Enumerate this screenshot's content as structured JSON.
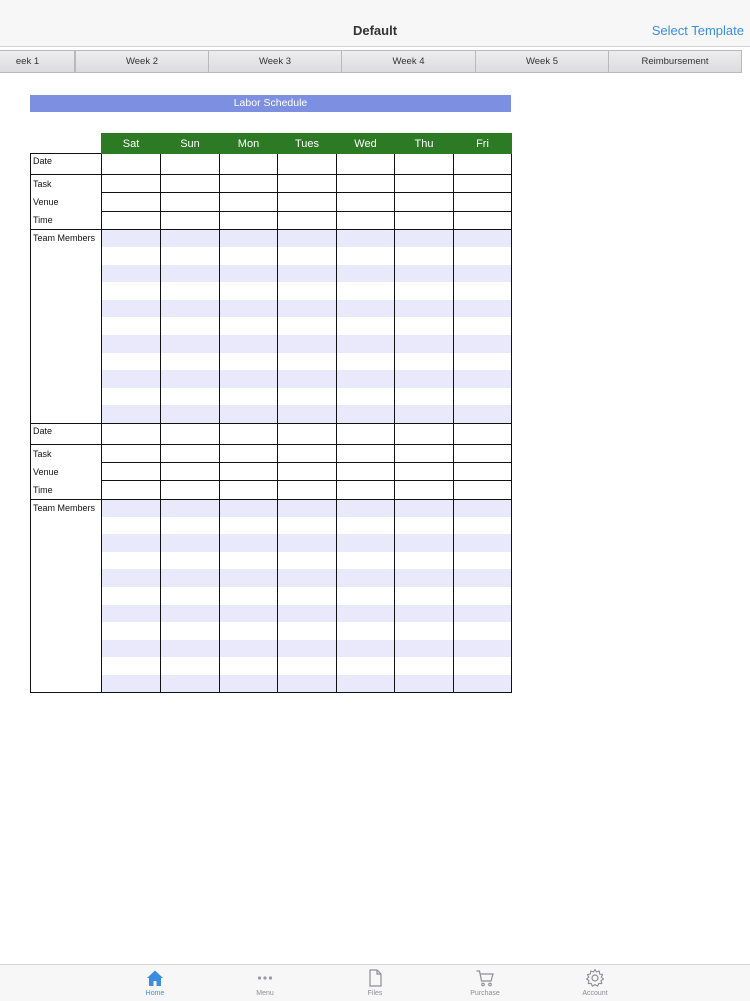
{
  "nav": {
    "title": "Default",
    "action": "Select Template"
  },
  "tabs": [
    "eek 1",
    "Week 2",
    "Week 3",
    "Week 4",
    "Week 5",
    "Reimbursement"
  ],
  "sheet": {
    "title": "Labor Schedule",
    "days": [
      "Sat",
      "Sun",
      "Mon",
      "Tues",
      "Wed",
      "Thu",
      "Fri"
    ],
    "blocks": [
      {
        "date": "Date",
        "task": "Task",
        "venue": "Venue",
        "time": "Time",
        "team": "Team Members"
      },
      {
        "date": "Date",
        "task": "Task",
        "venue": "Venue",
        "time": "Time",
        "team": "Team Members"
      }
    ]
  },
  "tabbar": {
    "items": [
      {
        "label": "Home",
        "icon": "home-icon",
        "active": true
      },
      {
        "label": "Menu",
        "icon": "more-icon",
        "active": false
      },
      {
        "label": "Files",
        "icon": "file-icon",
        "active": false
      },
      {
        "label": "Purchase",
        "icon": "cart-icon",
        "active": false
      },
      {
        "label": "Account",
        "icon": "gear-icon",
        "active": false
      }
    ],
    "active_color": "#3b8de0",
    "inactive_color": "#8e8e93"
  },
  "colors": {
    "header_green": "#2d7a25",
    "title_blue": "#7d8fe0",
    "stripe": "#e9e9fb",
    "accent": "#3b8de0"
  }
}
